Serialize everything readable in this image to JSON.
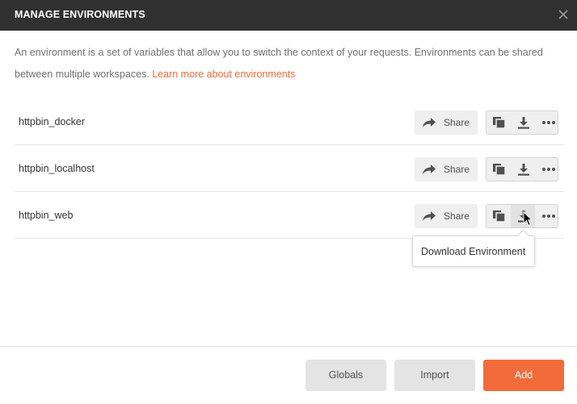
{
  "header": {
    "title": "MANAGE ENVIRONMENTS",
    "close_icon": "close-icon"
  },
  "description": {
    "text": "An environment is a set of variables that allow you to switch the context of your requests. Environments can be shared between multiple workspaces. ",
    "link_text": "Learn more about environments"
  },
  "environments": [
    {
      "name": "httpbin_docker",
      "share_label": "Share"
    },
    {
      "name": "httpbin_localhost",
      "share_label": "Share"
    },
    {
      "name": "httpbin_web",
      "share_label": "Share"
    }
  ],
  "icons": {
    "share": "share-arrow-icon",
    "duplicate": "duplicate-icon",
    "download": "download-icon",
    "more": "more-horizontal-icon"
  },
  "tooltip": {
    "text": "Download Environment"
  },
  "footer": {
    "globals_label": "Globals",
    "import_label": "Import",
    "add_label": "Add"
  },
  "colors": {
    "header_bg": "#303030",
    "accent": "#f26b3a",
    "button_bg": "#e4e4e4"
  }
}
